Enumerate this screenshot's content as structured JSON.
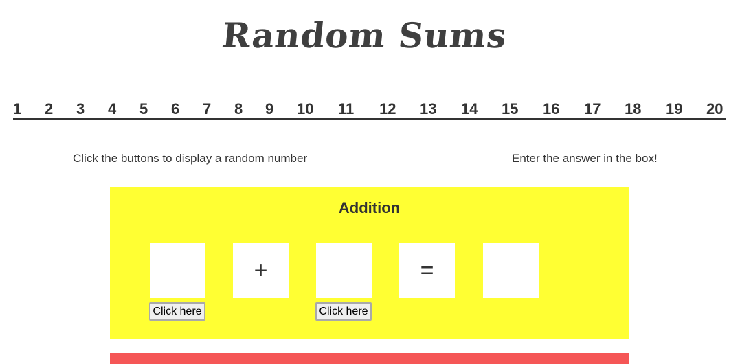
{
  "header": {
    "title": "Random Sums"
  },
  "nav": {
    "items": [
      "1",
      "2",
      "3",
      "4",
      "5",
      "6",
      "7",
      "8",
      "9",
      "10",
      "11",
      "12",
      "13",
      "14",
      "15",
      "16",
      "17",
      "18",
      "19",
      "20"
    ]
  },
  "instructions": {
    "left": "Click the buttons to display a random number",
    "right": "Enter the answer in the box!"
  },
  "addition": {
    "title": "Addition",
    "num1": "",
    "num2": "",
    "plus": "+",
    "equals": "=",
    "answer": "",
    "button1_label": "Click here",
    "button2_label": "Click here"
  },
  "colors": {
    "panel_bg": "#ffff33",
    "next_panel_bg": "#f55656",
    "text": "#333333"
  }
}
